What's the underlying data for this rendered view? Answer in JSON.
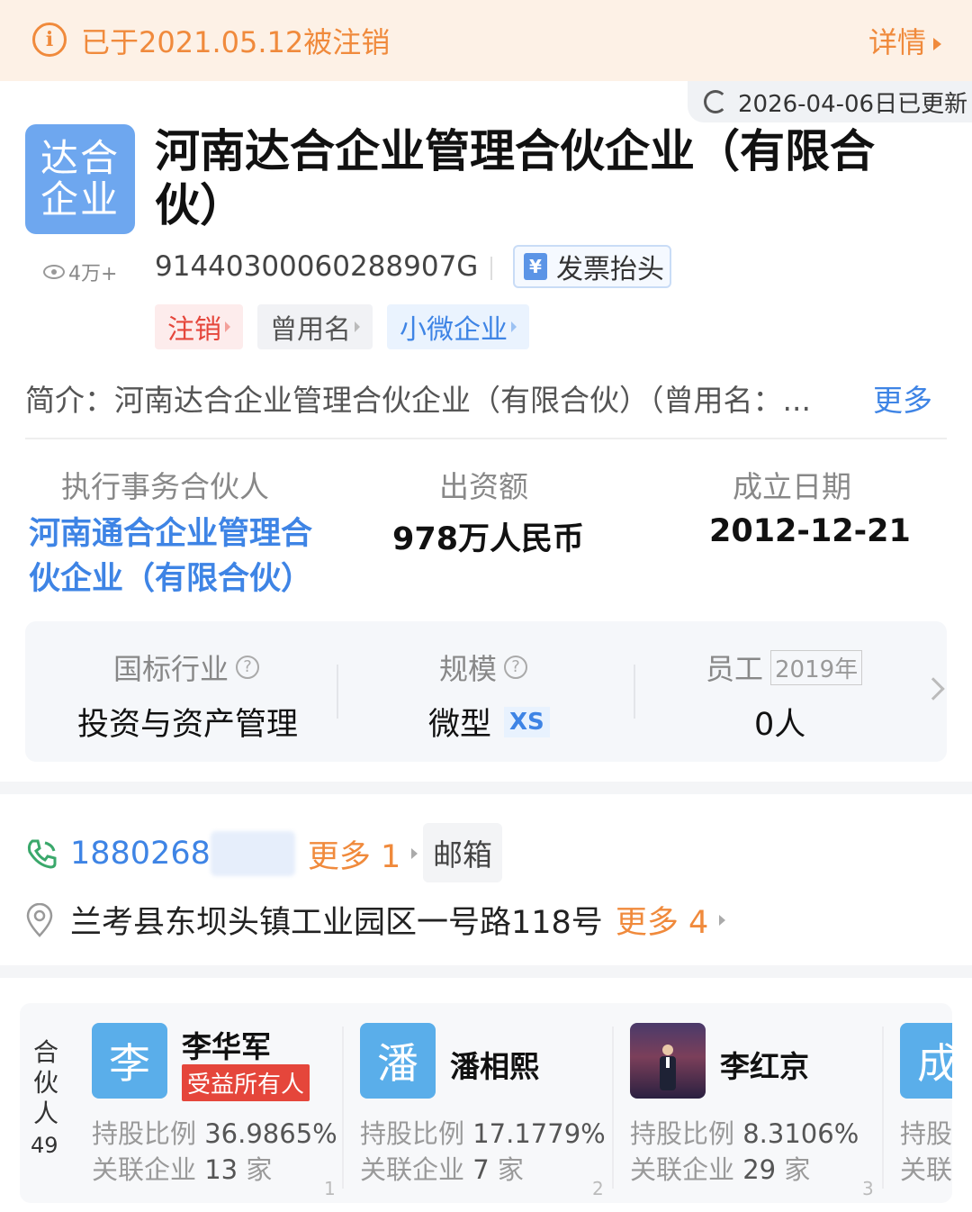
{
  "banner": {
    "text": "已于2021.05.12被注销",
    "details_label": "详情"
  },
  "updated_label": "2026-04-06日已更新",
  "company": {
    "logo_line1": "达合",
    "logo_line2": "企业",
    "name": "河南达合企业管理合伙企业（有限合伙）",
    "views": "4万+",
    "credit_code": "914403000602889 07G",
    "invoice_label": "发票抬头",
    "invoice_icon_glyph": "¥"
  },
  "tags": [
    {
      "label": "注销"
    },
    {
      "label": "曾用名"
    },
    {
      "label": "小微企业"
    }
  ],
  "intro": {
    "label": "简介：",
    "text": "河南达合企业管理合伙企业（有限合伙）（曾用名：...",
    "more": "更多"
  },
  "key_info": {
    "partner_label": "执行事务合伙人",
    "partner_value": "河南通合企业管理合伙企业（有限合伙）",
    "capital_label": "出资额",
    "capital_value": "978万人民币",
    "date_label": "成立日期",
    "date_value": "2012-12-21"
  },
  "industry_box": {
    "industry_label": "国标行业",
    "industry_value": "投资与资产管理",
    "scale_label": "规模",
    "scale_value": "微型",
    "scale_badge": "XS",
    "staff_label": "员工",
    "staff_year": "2019年",
    "staff_value": "0人"
  },
  "contact": {
    "phone": "1880268",
    "phone_more": "更多 1",
    "email_label": "邮箱",
    "address": "兰考县东坝头镇工业园区一号路118号",
    "address_more": "更多 4"
  },
  "partners": {
    "label": "合伙人",
    "count": "49",
    "share_label": "持股比例",
    "rel_label": "关联企业",
    "rel_unit": "家",
    "items": [
      {
        "avatar": "李",
        "name": "李华军",
        "badge": "受益所有人",
        "share": "36.9865%",
        "related": "13",
        "index": "1"
      },
      {
        "avatar": "潘",
        "name": "潘相熙",
        "share": "17.1779%",
        "related": "7",
        "index": "2"
      },
      {
        "avatar": "",
        "name": "李红京",
        "share": "8.3106%",
        "related": "29",
        "index": "3"
      },
      {
        "avatar": "成",
        "share_partial": "持股",
        "rel_partial": "关联"
      }
    ]
  },
  "colors": {
    "accent_blue": "#3e84e5",
    "warning_orange": "#f08a3c",
    "cancel_red": "#e5463b",
    "logo_blue": "#6ea7ef"
  }
}
